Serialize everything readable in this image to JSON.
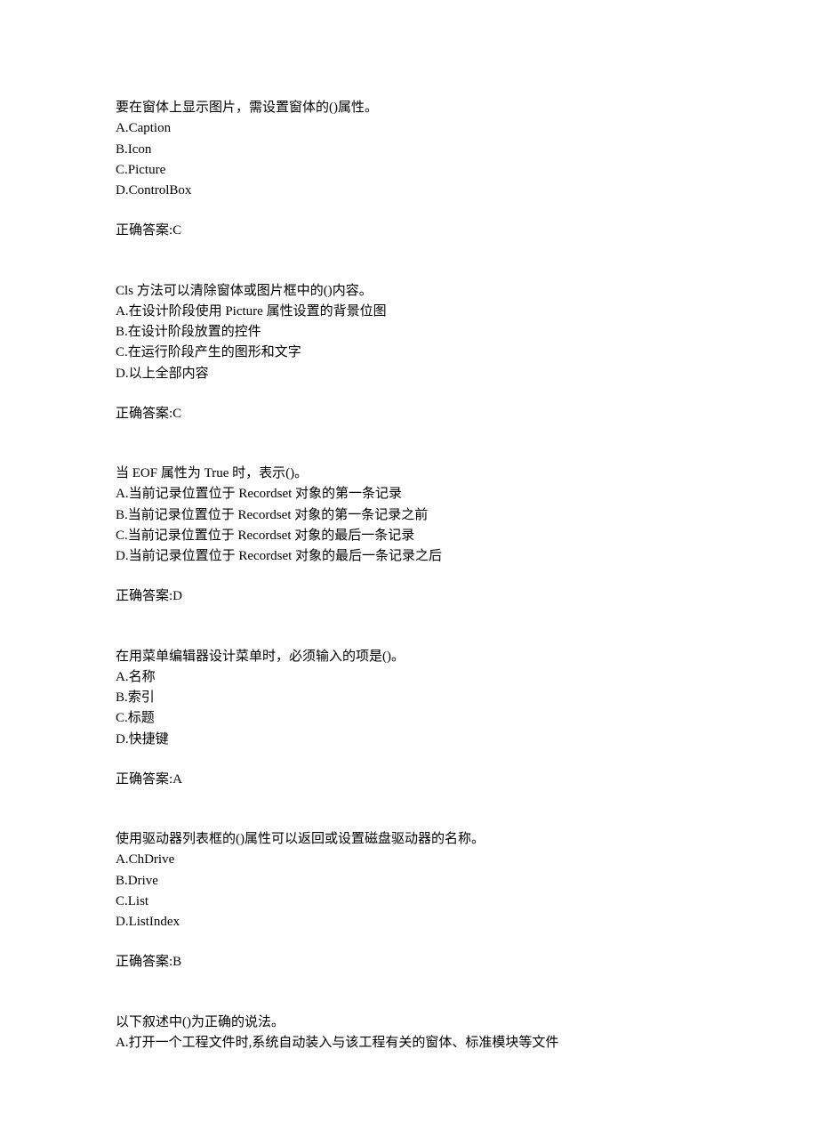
{
  "questions": [
    {
      "prompt": "要在窗体上显示图片，需设置窗体的()属性。",
      "optA": "A.Caption",
      "optB": "B.Icon",
      "optC": "C.Picture",
      "optD": "D.ControlBox",
      "answer": "正确答案:C"
    },
    {
      "prompt": "Cls 方法可以清除窗体或图片框中的()内容。",
      "optA": "A.在设计阶段使用 Picture 属性设置的背景位图",
      "optB": "B.在设计阶段放置的控件",
      "optC": "C.在运行阶段产生的图形和文字",
      "optD": "D.以上全部内容",
      "answer": "正确答案:C"
    },
    {
      "prompt": "当 EOF 属性为 True 时，表示()。",
      "optA": "A.当前记录位置位于 Recordset 对象的第一条记录",
      "optB": "B.当前记录位置位于 Recordset 对象的第一条记录之前",
      "optC": "C.当前记录位置位于 Recordset 对象的最后一条记录",
      "optD": "D.当前记录位置位于 Recordset 对象的最后一条记录之后",
      "answer": "正确答案:D"
    },
    {
      "prompt": "在用菜单编辑器设计菜单时，必须输入的项是()。",
      "optA": "A.名称",
      "optB": "B.索引",
      "optC": "C.标题",
      "optD": "D.快捷键",
      "answer": "正确答案:A"
    },
    {
      "prompt": "使用驱动器列表框的()属性可以返回或设置磁盘驱动器的名称。",
      "optA": "A.ChDrive",
      "optB": "B.Drive",
      "optC": "C.List",
      "optD": "D.ListIndex",
      "answer": "正确答案:B"
    },
    {
      "prompt": "以下叙述中()为正确的说法。",
      "optA": "A.打开一个工程文件时,系统自动装入与该工程有关的窗体、标准模块等文件",
      "optB": "",
      "optC": "",
      "optD": "",
      "answer": ""
    }
  ]
}
